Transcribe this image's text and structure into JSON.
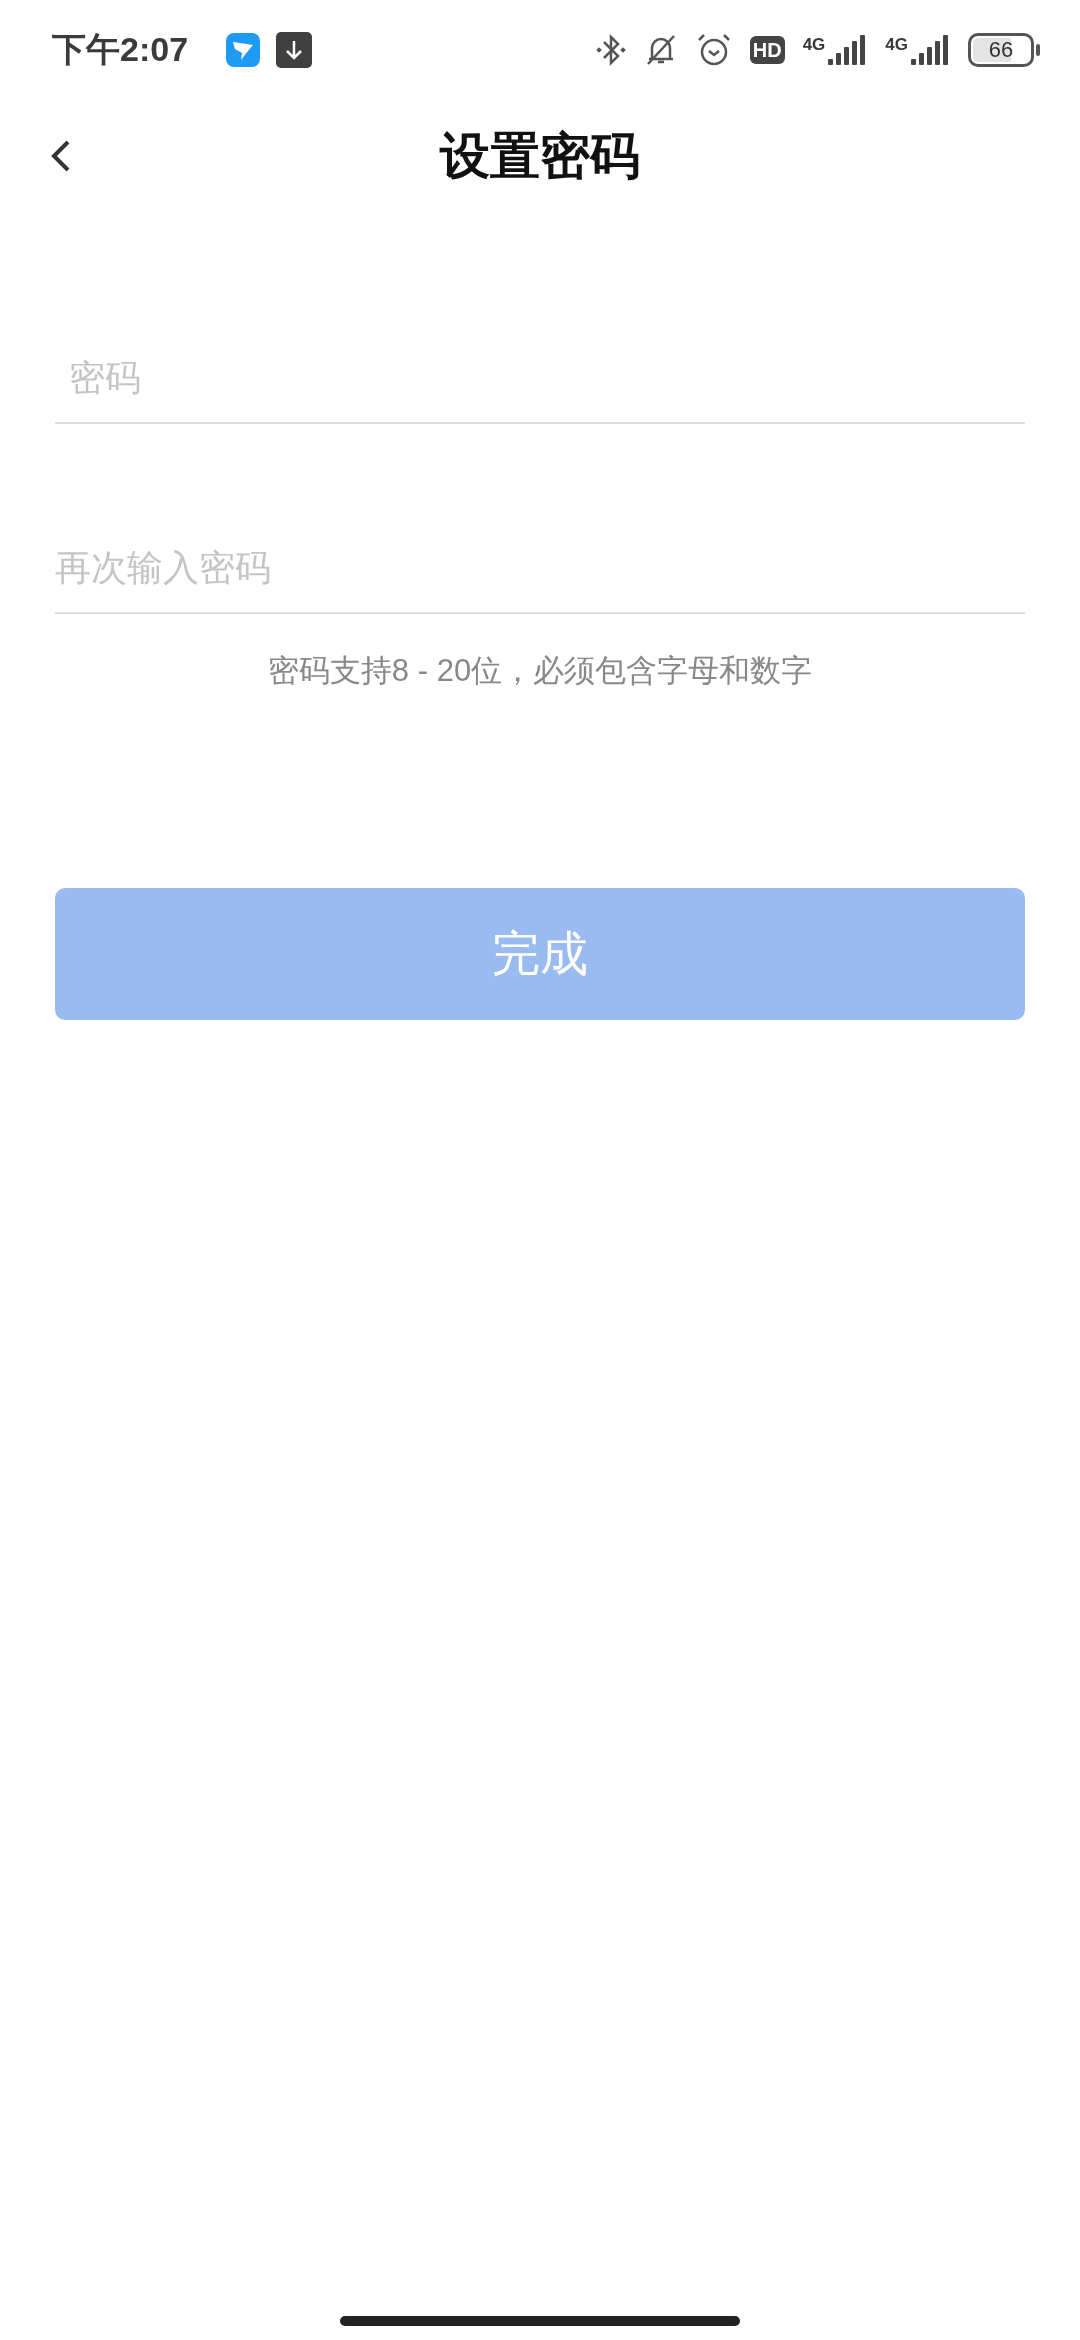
{
  "status_bar": {
    "time": "下午2:07",
    "hd_badge": "HD",
    "network_1": "4G",
    "network_2": "4G",
    "battery": "66"
  },
  "header": {
    "title": "设置密码"
  },
  "fields": [
    {
      "placeholder": "密码"
    },
    {
      "placeholder": "再次输入密码"
    }
  ],
  "hint": "密码支持8 - 20位，必须包含字母和数字",
  "submit_button": {
    "label": "完成",
    "disabled": true
  }
}
